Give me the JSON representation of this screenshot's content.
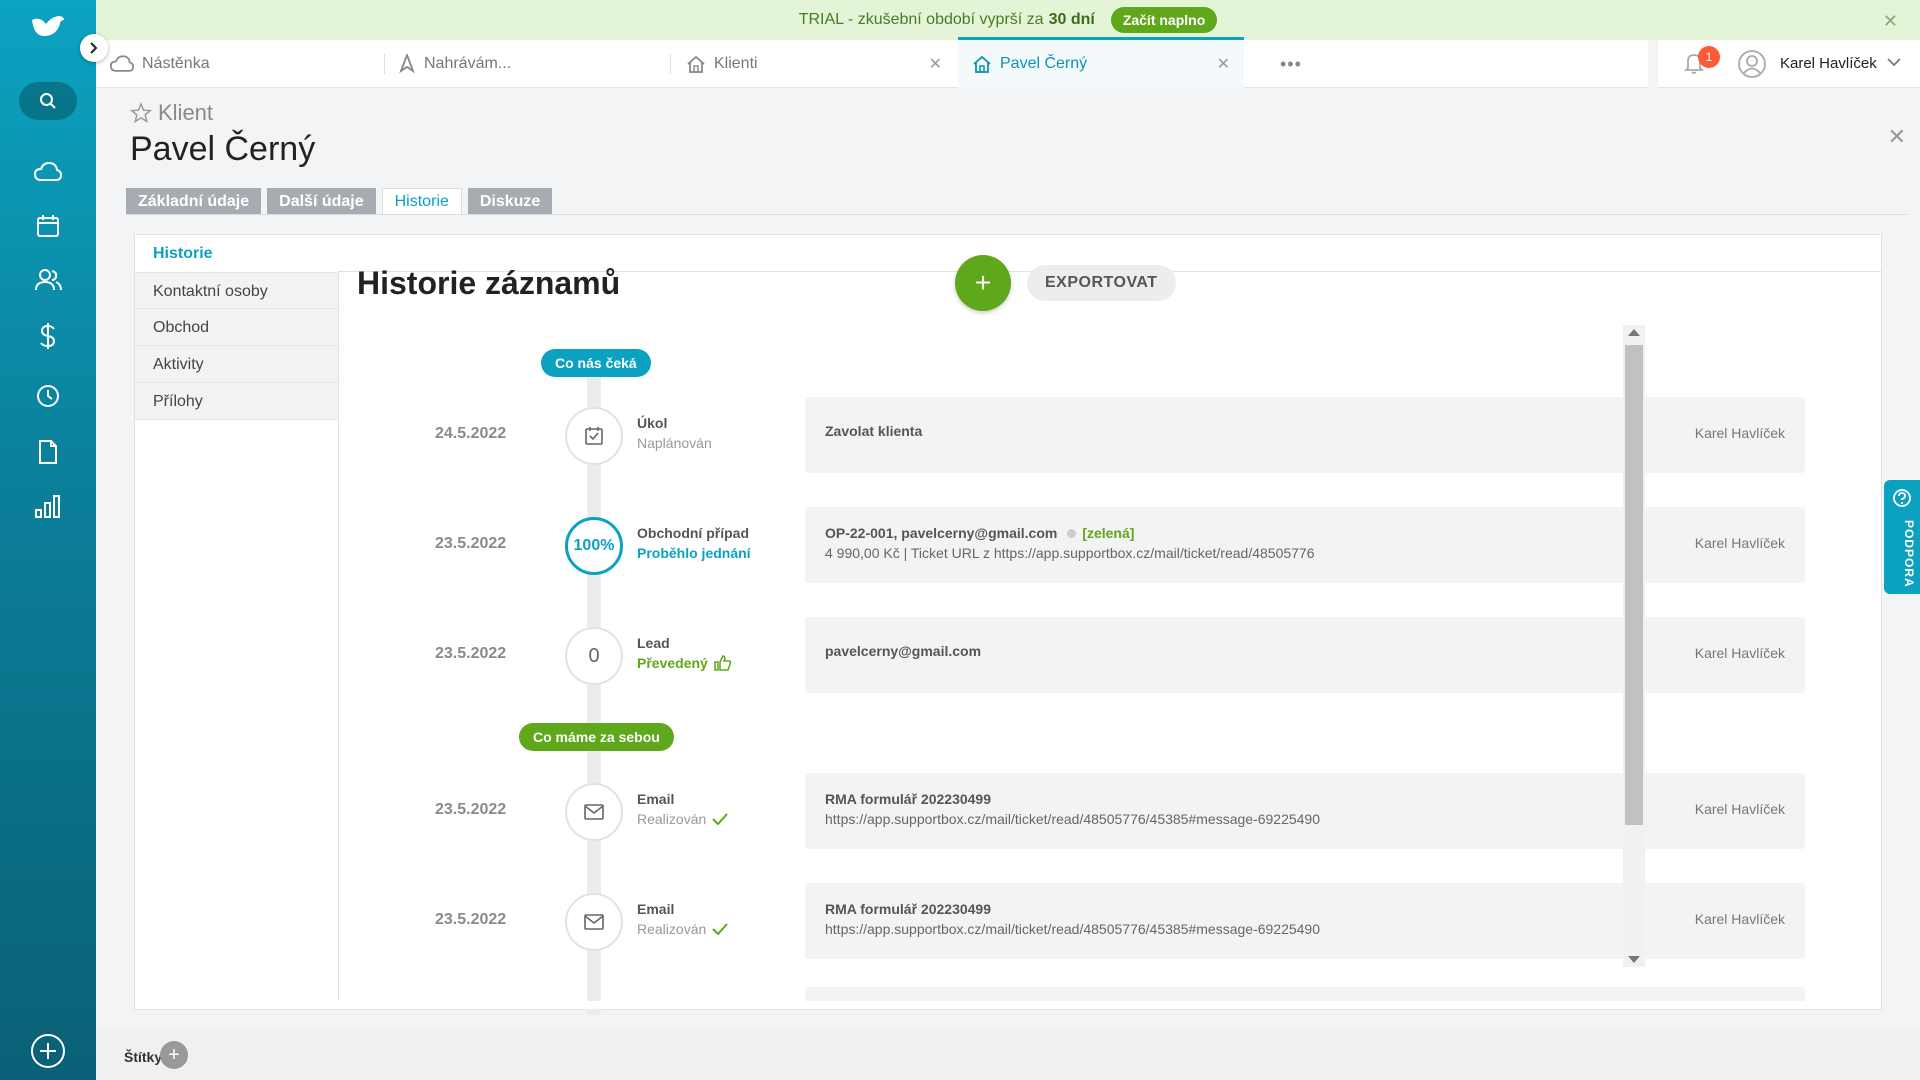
{
  "trial": {
    "text": "TRIAL - zkušební období vyprší za",
    "days": "30 dní",
    "button": "Začít naplno"
  },
  "tabs": [
    {
      "label": "Nástěnka",
      "icon": "cloud-icon"
    },
    {
      "label": "Nahrávám...",
      "icon": "rocket-icon"
    },
    {
      "label": "Klienti",
      "icon": "home-icon"
    },
    {
      "label": "Pavel Černý",
      "icon": "home-icon"
    }
  ],
  "user": {
    "name": "Karel Havlíček",
    "notifications": "1"
  },
  "header": {
    "breadcrumb": "Klient",
    "title": "Pavel Černý"
  },
  "client_tabs": [
    "Základní údaje",
    "Další údaje",
    "Historie",
    "Diskuze"
  ],
  "subnav": [
    "Historie",
    "Kontaktní osoby",
    "Obchod",
    "Aktivity",
    "Přílohy"
  ],
  "history": {
    "title": "Historie záznamů",
    "export": "EXPORTOVAT",
    "add": "+",
    "section_upcoming": "Co nás čeká",
    "section_done": "Co máme za sebou",
    "entries": [
      {
        "date": "24.5.2022",
        "type": "Úkol",
        "status": "Naplánován",
        "title": "Zavolat klienta",
        "detail": "",
        "owner": "Karel Havlíček",
        "circle": ""
      },
      {
        "date": "23.5.2022",
        "type": "Obchodní případ",
        "status": "Proběhlo jednání",
        "title": "OP-22-001, pavelcerny@gmail.com",
        "tag": "[zelená]",
        "detail": "4 990,00 Kč | Ticket URL z https://app.supportbox.cz/mail/ticket/read/48505776",
        "owner": "Karel Havlíček",
        "circle": "100%"
      },
      {
        "date": "23.5.2022",
        "type": "Lead",
        "status": "Převedený",
        "title": "pavelcerny@gmail.com",
        "detail": "",
        "owner": "Karel Havlíček",
        "circle": "0"
      },
      {
        "date": "23.5.2022",
        "type": "Email",
        "status": "Realizován",
        "title": "RMA formulář 202230499",
        "detail": "https://app.supportbox.cz/mail/ticket/read/48505776/45385#message-69225490",
        "owner": "Karel Havlíček",
        "circle": ""
      },
      {
        "date": "23.5.2022",
        "type": "Email",
        "status": "Realizován",
        "title": "RMA formulář 202230499",
        "detail": "https://app.supportbox.cz/mail/ticket/read/48505776/45385#message-69225490",
        "owner": "Karel Havlíček",
        "circle": ""
      }
    ]
  },
  "bottom": {
    "tags_label": "Štítky"
  },
  "support": {
    "label": "PODPORA"
  },
  "colors": {
    "accent": "#0aa2c0",
    "green": "#5fa71b",
    "badge": "#ff5a36"
  }
}
